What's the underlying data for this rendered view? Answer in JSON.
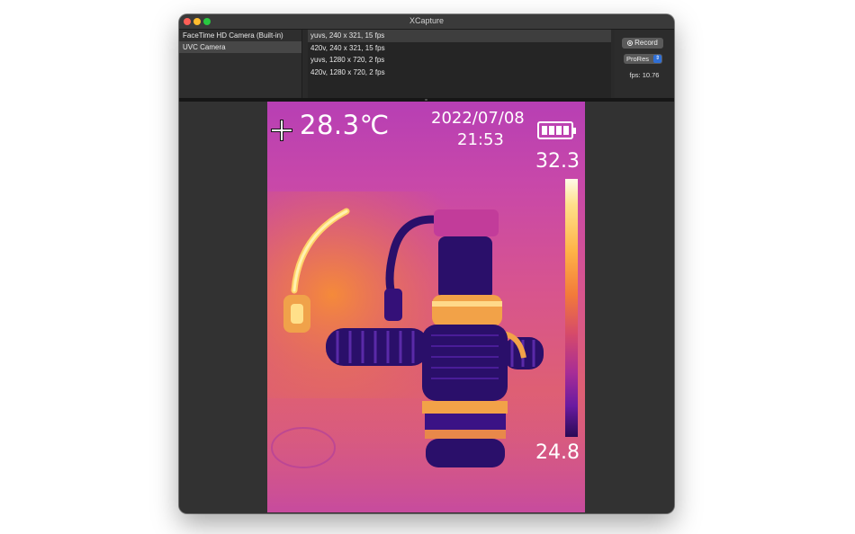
{
  "window": {
    "title": "XCapture"
  },
  "devices": [
    {
      "label": "FaceTime HD Camera (Built-in)",
      "selected": false
    },
    {
      "label": "UVC Camera",
      "selected": true
    }
  ],
  "formats": [
    {
      "label": "yuvs, 240 x 321, 15 fps",
      "selected": true
    },
    {
      "label": "420v, 240 x 321, 15 fps",
      "selected": false
    },
    {
      "label": "yuvs, 1280 x 720, 2 fps",
      "selected": false
    },
    {
      "label": "420v, 1280 x 720, 2 fps",
      "selected": false
    }
  ],
  "controls": {
    "record_label": "Record",
    "codec_value": "ProRes",
    "fps_text": "fps: 10.76"
  },
  "thermal": {
    "center_temperature": "28.3℃",
    "date": "2022/07/08",
    "time": "21:53",
    "scale_max": "32.3",
    "scale_min": "24.8"
  }
}
